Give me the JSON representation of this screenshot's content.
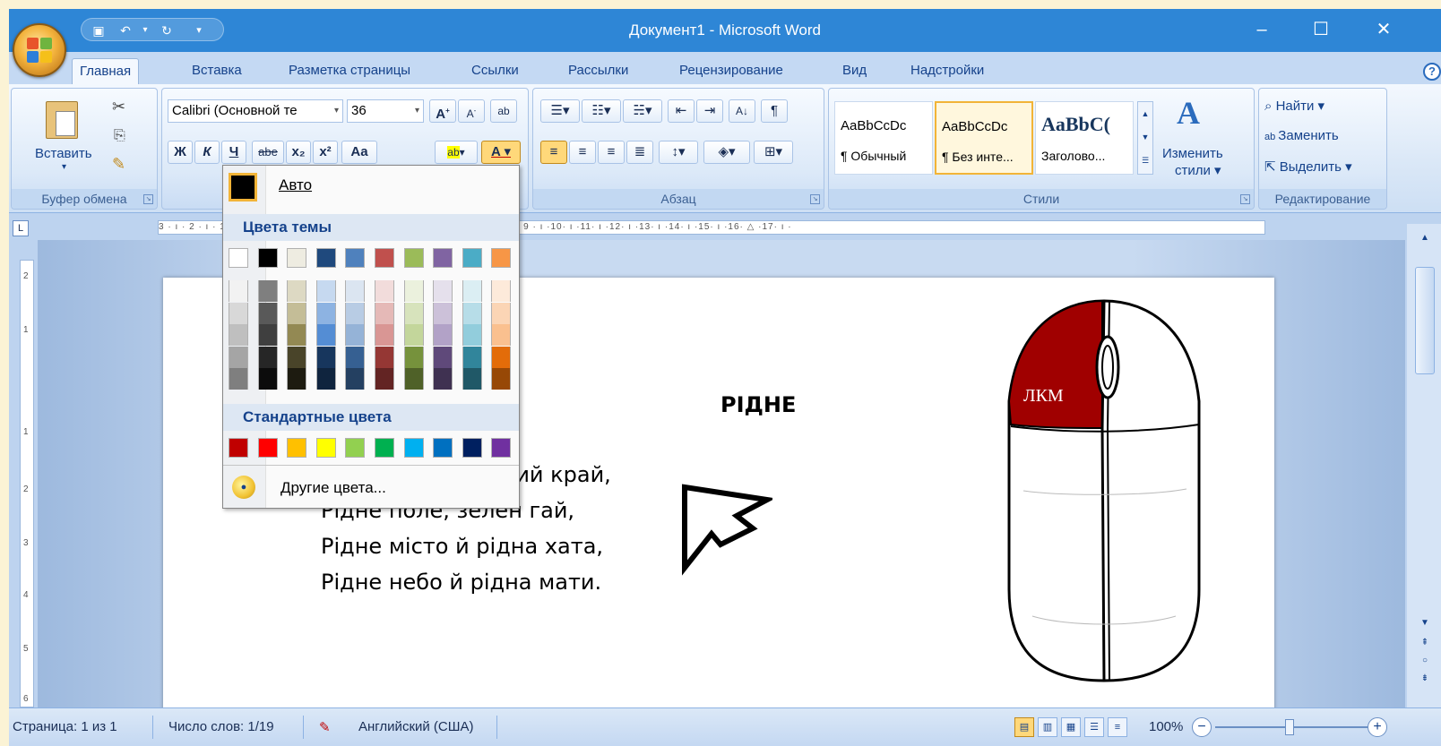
{
  "window": {
    "title": "Документ1 - Microsoft Word"
  },
  "tabs": [
    "Главная",
    "Вставка",
    "Разметка страницы",
    "Ссылки",
    "Рассылки",
    "Рецензирование",
    "Вид",
    "Надстройки"
  ],
  "ribbon": {
    "clipboard": {
      "paste_label": "Вставить",
      "group_label": "Буфер обмена"
    },
    "font": {
      "font_name": "Calibri (Основной те",
      "font_size": "36",
      "bold": "Ж",
      "italic": "К",
      "underline": "Ч",
      "strike": "abe",
      "subscript": "x₂",
      "superscript": "x²",
      "case": "Aa",
      "grow": "A",
      "shrink": "A"
    },
    "paragraph": {
      "group_label": "Абзац"
    },
    "styles": {
      "items": [
        {
          "sample": "AaBbCcDc",
          "name": "¶ Обычный"
        },
        {
          "sample": "AaBbCcDc",
          "name": "¶ Без инте..."
        },
        {
          "sample": "AaBbC(",
          "name": "Заголово..."
        }
      ],
      "change_label_1": "Изменить",
      "change_label_2": "стили ▾",
      "group_label": "Стили"
    },
    "editing": {
      "find": "Найти ▾",
      "replace": "Заменить",
      "select": "Выделить ▾",
      "group_label": "Редактирование"
    }
  },
  "ruler": {
    "text": "3 · ı · 2 · ı · 1 · ı · · · ı · 1 · ı · 2 · ı · 3 · ı · 4 · ı · 5 · ı · 6 · ı · 7 · ı · 8 · ı · 9 · ı ·10· ı ·11· ı ·12· ı ·13· ı ·14· ı ·15· ı ·16· △ ·17· ı ·"
  },
  "document": {
    "title": "РІДНЕ",
    "lines": [
      "Рідне слово, рідний край,",
      "Рідне поле, зелен гай,",
      "Рідне місто й рідна хата,",
      "Рідне небо й рідна мати."
    ],
    "mouse_label": "ЛКМ"
  },
  "color_menu": {
    "auto_label": "Авто",
    "theme_header": "Цвета темы",
    "standard_header": "Стандартные цвета",
    "more_label": "Другие цвета...",
    "theme_colors": [
      "#ffffff",
      "#000000",
      "#eeece1",
      "#1f497d",
      "#4f81bd",
      "#c0504d",
      "#9bbb59",
      "#8064a2",
      "#4bacc6",
      "#f79646"
    ],
    "theme_shades": [
      [
        "#f2f2f2",
        "#d8d8d8",
        "#bfbfbf",
        "#a5a5a5",
        "#7f7f7f"
      ],
      [
        "#7f7f7f",
        "#595959",
        "#3f3f3f",
        "#262626",
        "#0c0c0c"
      ],
      [
        "#ddd9c3",
        "#c4bd97",
        "#938953",
        "#494429",
        "#1d1b10"
      ],
      [
        "#c6d9f0",
        "#8db3e2",
        "#548dd4",
        "#17365d",
        "#0f243e"
      ],
      [
        "#dbe5f1",
        "#b8cce4",
        "#95b3d7",
        "#366092",
        "#244061"
      ],
      [
        "#f2dcdb",
        "#e5b9b7",
        "#d99694",
        "#953734",
        "#632423"
      ],
      [
        "#ebf1dd",
        "#d7e3bc",
        "#c3d69b",
        "#76923c",
        "#4f6128"
      ],
      [
        "#e5e0ec",
        "#ccc1d9",
        "#b2a2c7",
        "#5f497a",
        "#3f3151"
      ],
      [
        "#dbeef3",
        "#b7dde8",
        "#92cddc",
        "#31859b",
        "#205867"
      ],
      [
        "#fdeada",
        "#fbd5b5",
        "#fac08f",
        "#e36c09",
        "#974806"
      ]
    ],
    "standard_colors": [
      "#c00000",
      "#ff0000",
      "#ffc000",
      "#ffff00",
      "#92d050",
      "#00b050",
      "#00b0f0",
      "#0070c0",
      "#002060",
      "#7030a0"
    ]
  },
  "status": {
    "page": "Страница: 1 из 1",
    "words": "Число слов: 1/19",
    "language": "Английский (США)",
    "zoom": "100%"
  }
}
